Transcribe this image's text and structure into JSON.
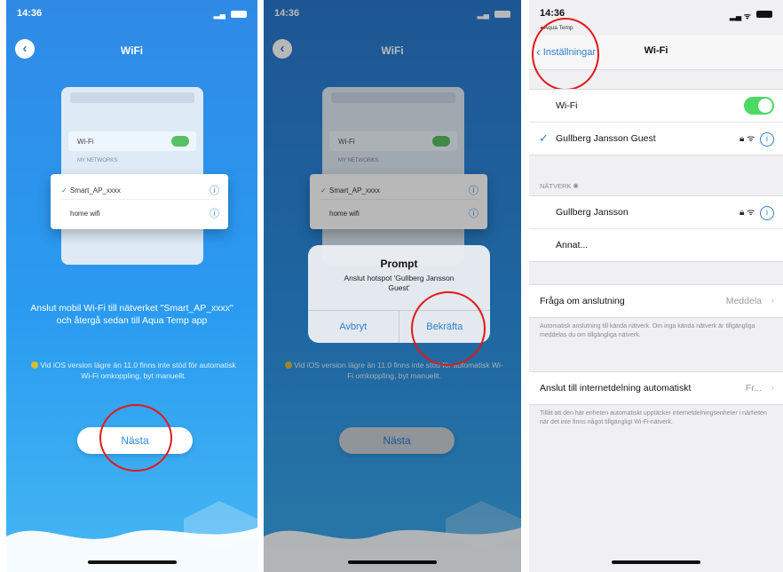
{
  "panel1": {
    "time": "14:36",
    "title": "WiFi",
    "illus": {
      "wifi_row": "Wi-Fi",
      "networks_head": "MY NETWORKS",
      "net1": "Smart_AP_xxxx",
      "net2": "home wifi"
    },
    "description": "Anslut mobil Wi-Fi till nätverket \"Smart_AP_xxxx\" och återgå sedan till Aqua Temp app",
    "note": "Vid iOS version lägre än 11.0 finns inte stöd för automatisk Wi-Fi omkoppling, byt manuellt.",
    "next_label": "Nästa"
  },
  "panel2": {
    "time": "14:36",
    "title": "WiFi",
    "illus": {
      "wifi_row": "Wi-Fi",
      "networks_head": "MY NETWORKS",
      "net1": "Smart_AP_xxxx",
      "net2": "home wifi"
    },
    "dialog_title": "Prompt",
    "dialog_message": "Anslut hotspot 'Gullberg Jansson Guest'",
    "cancel_label": "Avbryt",
    "confirm_label": "Bekräfta",
    "note": "Vid iOS version lägre än 11.0 finns inte stöd för automatisk Wi-Fi omkoppling, byt manuellt.",
    "next_label": "Nästa"
  },
  "panel3": {
    "time": "14:36",
    "source_app": "◂ Aqua Temp",
    "back_label": "Inställningar",
    "title": "Wi-Fi",
    "wifi_label": "Wi-Fi",
    "wifi_on": true,
    "connected_network": "Gullberg Jansson Guest",
    "networks_header": "NÄTVERK",
    "networks": [
      "Gullberg Jansson",
      "Annat..."
    ],
    "ask_join_label": "Fråga om anslutning",
    "ask_join_value": "Meddela",
    "ask_join_footer": "Automatisk anslutning till kända nätverk. Om inga kända nätverk är tillgängliga meddelas du om tillgängliga nätverk.",
    "hotspot_label": "Anslut till internetdelning automatiskt",
    "hotspot_value": "Fr...",
    "hotspot_footer": "Tillåt att den här enheten automatiskt upptäcker internetdelningsenheter i närheten när det inte finns något tillgängligt Wi-Fi-nätverk."
  },
  "colors": {
    "annotation": "#e01a1a",
    "ios_blue": "#2f7fd0",
    "toggle_green": "#4cd964"
  }
}
